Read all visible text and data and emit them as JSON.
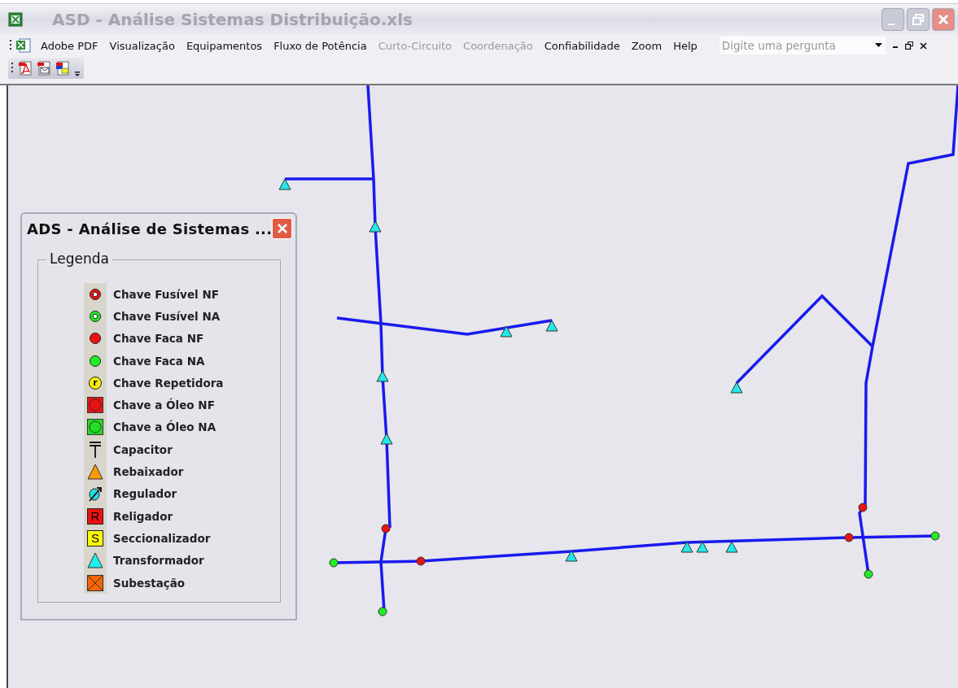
{
  "window": {
    "title": "ASD - Análise Sistemas Distribuição.xls"
  },
  "menu": [
    {
      "label": "Adobe PDF",
      "disabled": false
    },
    {
      "label": "Visualização",
      "disabled": false
    },
    {
      "label": "Equipamentos",
      "disabled": false
    },
    {
      "label": "Fluxo de Potência",
      "disabled": false
    },
    {
      "label": "Curto-Circuito",
      "disabled": true
    },
    {
      "label": "Coordenação",
      "disabled": true
    },
    {
      "label": "Confiabilidade",
      "disabled": false
    },
    {
      "label": "Zoom",
      "disabled": false
    },
    {
      "label": "Help",
      "disabled": false
    }
  ],
  "question": {
    "placeholder": "Digite uma pergunta"
  },
  "legend_window": {
    "title": "ADS - Análise de Sistemas ...",
    "group_title": "Legenda",
    "items": [
      {
        "kind": "fuse_nf",
        "label": "Chave Fusível NF"
      },
      {
        "kind": "fuse_na",
        "label": "Chave Fusível NA"
      },
      {
        "kind": "knife_nf",
        "label": "Chave Faca NF"
      },
      {
        "kind": "knife_na",
        "label": "Chave Faca NA"
      },
      {
        "kind": "repeater",
        "label": "Chave Repetidora",
        "letter": "r"
      },
      {
        "kind": "oil_nf",
        "label": "Chave a Óleo NF"
      },
      {
        "kind": "oil_na",
        "label": "Chave a Óleo NA"
      },
      {
        "kind": "capacitor",
        "label": "Capacitor"
      },
      {
        "kind": "step_down",
        "label": "Rebaixador"
      },
      {
        "kind": "regulator",
        "label": "Regulador"
      },
      {
        "kind": "recloser",
        "label": "Religador",
        "letter": "R"
      },
      {
        "kind": "sectionalizer",
        "label": "Seccionalizador",
        "letter": "S"
      },
      {
        "kind": "transformer",
        "label": "Transformador"
      },
      {
        "kind": "substation",
        "label": "Subestação"
      }
    ]
  }
}
